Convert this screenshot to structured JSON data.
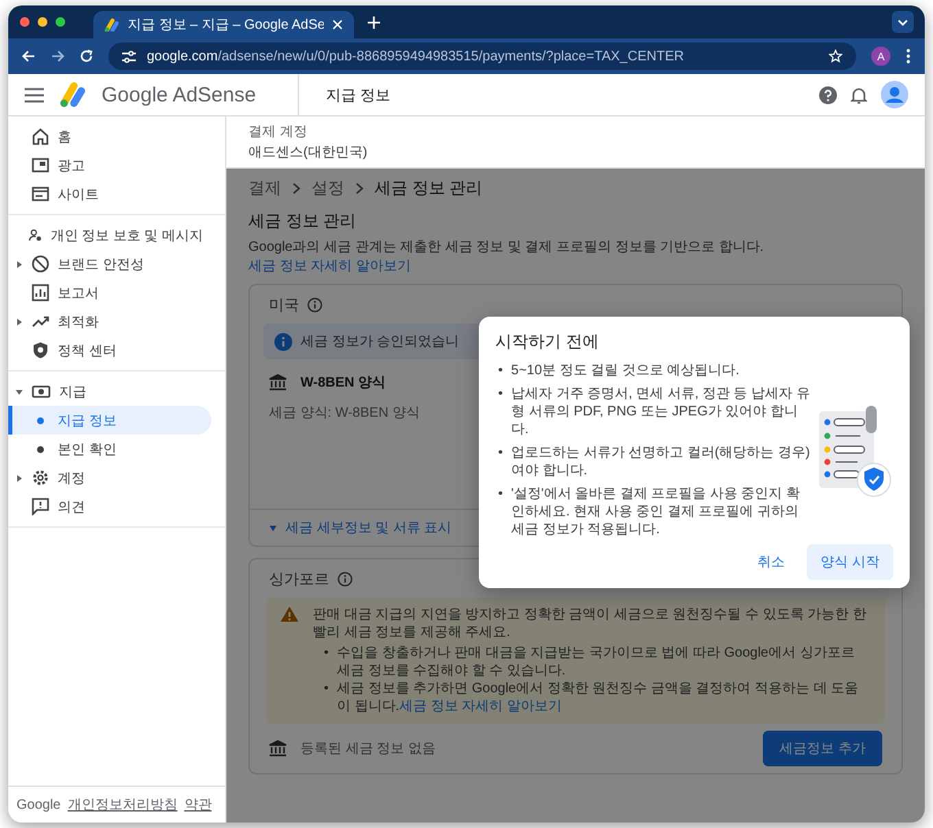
{
  "browser": {
    "tab_title": "지급 정보 – 지급 – Google AdSe",
    "url_host": "google.com",
    "url_path": "/adsense/new/u/0/pub-8868959494983515/payments/?place=TAX_CENTER",
    "profile_initial": "A"
  },
  "header": {
    "product": "Google AdSense",
    "page_title": "지급 정보"
  },
  "sidebar": {
    "groups": [
      [
        {
          "label": "홈",
          "selected": false
        },
        {
          "label": "광고",
          "selected": false
        },
        {
          "label": "사이트",
          "selected": false
        }
      ],
      [
        {
          "label": "개인 정보 보호 및 메시지",
          "selected": false
        },
        {
          "label": "브랜드 안전성",
          "selected": false,
          "expanded": false
        },
        {
          "label": "보고서",
          "selected": false
        },
        {
          "label": "최적화",
          "selected": false,
          "expanded": false
        },
        {
          "label": "정책 센터",
          "selected": false
        }
      ],
      [
        {
          "label": "지급",
          "selected": false,
          "expanded": true,
          "children": [
            {
              "label": "지급 정보",
              "selected": true
            },
            {
              "label": "본인 확인",
              "selected": false
            }
          ]
        },
        {
          "label": "계정",
          "selected": false,
          "expanded": false
        },
        {
          "label": "의견",
          "selected": false
        }
      ]
    ],
    "footer": {
      "brand": "Google",
      "links": [
        "개인정보처리방침",
        "약관"
      ]
    }
  },
  "account": {
    "label": "결제 계정",
    "value": "애드센스(대한민국)"
  },
  "breadcrumb": [
    "결제",
    "설정",
    "세금 정보 관리"
  ],
  "section": {
    "title": "세금 정보 관리",
    "description": "Google과의 세금 관계는 제출한 세금 정보 및 결제 프로필의 정보를 기반으로 합니다.",
    "link": "세금 정보 자세히 알아보기"
  },
  "us_card": {
    "country": "미국",
    "banner": "세금 정보가 승인되었습니",
    "form_name": "W-8BEN 양식",
    "form_detail": "세금 양식: W-8BEN 양식",
    "details_link": "세금 세부정보 및 서류 표시"
  },
  "sg_card": {
    "bullet": "•",
    "country": "싱가포르",
    "warning": "판매 대금 지급의 지연을 방지하고 정확한 금액이 세금으로 원천징수될 수 있도록 가능한 한 빨리 세금 정보를 제공해 주세요.",
    "bullets": [
      "수입을 창출하거나 판매 대금을 지급받는 국가이므로 법에 따라 Google에서 싱가포르 세금 정보를 수집해야 할 수 있습니다.",
      "세금 정보를 추가하면 Google에서 정확한 원천징수 금액을 결정하여 적용하는 데 도움이 됩니다."
    ],
    "bullet_link": "세금 정보 자세히 알아보기",
    "empty_text": "등록된 세금 정보 없음",
    "add_button": "세금정보 추가"
  },
  "dialog": {
    "bullet": "•",
    "title": "시작하기 전에",
    "bullets": [
      "5~10분 정도 걸릴 것으로 예상됩니다.",
      "납세자 거주 증명서, 면세 서류, 정관 등 납세자 유형 서류의 PDF, PNG 또는 JPEG가 있어야 합니다.",
      "업로드하는 서류가 선명하고 컬러(해당하는 경우)여야 합니다.",
      "'설정'에서 올바른 결제 프로필을 사용 중인지 확인하세요. 현재 사용 중인 결제 프로필에 귀하의 세금 정보가 적용됩니다."
    ],
    "cancel": "취소",
    "start": "양식 시작"
  }
}
